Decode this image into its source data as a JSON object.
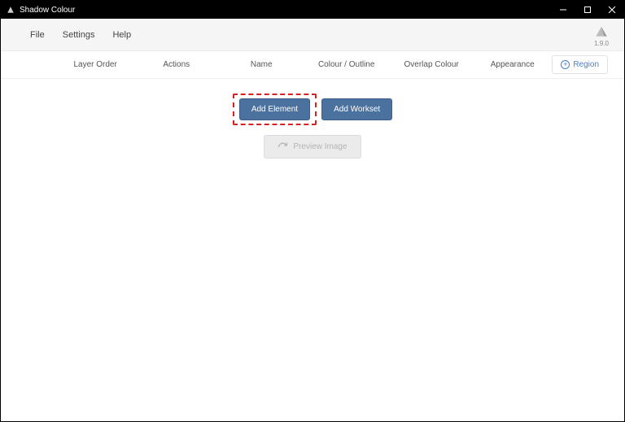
{
  "window": {
    "title": "Shadow Colour"
  },
  "menu": {
    "file": "File",
    "settings": "Settings",
    "help": "Help"
  },
  "version": "1.9.0",
  "columns": {
    "layer_order": "Layer Order",
    "actions": "Actions",
    "name": "Name",
    "colour_outline": "Colour / Outline",
    "overlap_colour": "Overlap Colour",
    "appearance": "Appearance"
  },
  "buttons": {
    "region": "Region",
    "add_element": "Add Element",
    "add_workset": "Add Workset",
    "preview_image": "Preview Image"
  }
}
